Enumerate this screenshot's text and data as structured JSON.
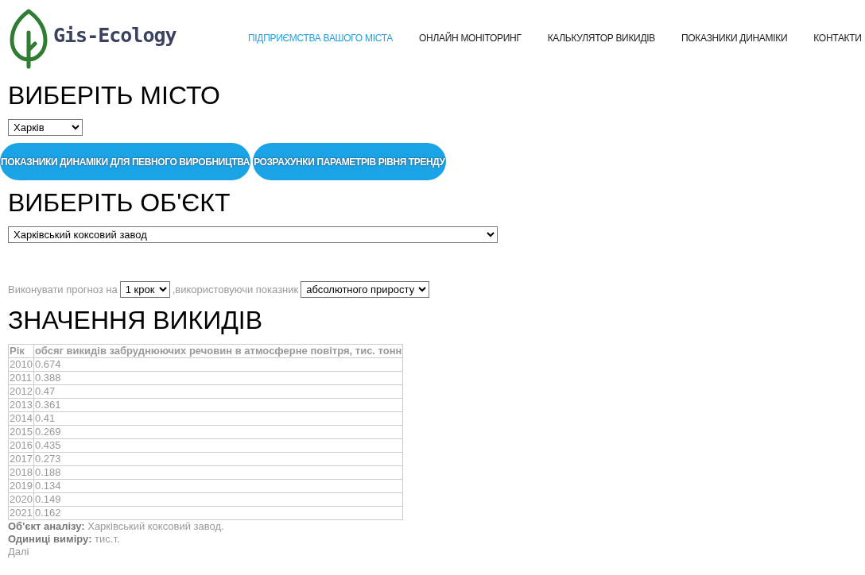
{
  "logo": {
    "text": "Gis-Ecology"
  },
  "nav": [
    {
      "label": "ПІДПРИЄМСТВА ВАШОГО МІСТА",
      "selected": true
    },
    {
      "label": "ОНЛАЙН МОНІТОРИНГ",
      "selected": false
    },
    {
      "label": "КАЛЬКУЛЯТОР ВИКИДІВ",
      "selected": false
    },
    {
      "label": "ПОКАЗНИКИ ДИНАМІКИ",
      "selected": false
    },
    {
      "label": "КОНТАКТИ",
      "selected": false
    }
  ],
  "city_heading": "ВИБЕРІТЬ МІСТО",
  "city_select": {
    "value": "Харків"
  },
  "buttons": [
    "ПОКАЗНИКИ ДИНАМІКИ ДЛЯ ПЕВНОГО ВИРОБНИЦТВА",
    "РОЗРАХУНКИ ПАРАМЕТРІВ РІВНЯ ТРЕНДУ"
  ],
  "object_heading": "ВИБЕРІТЬ ОБ'ЄКТ",
  "object_select": {
    "value": "Харківський коксовий завод"
  },
  "forecast": {
    "prefix": "Виконувати прогноз на",
    "steps": "1 крок",
    "middle": ",використовуючи показник",
    "indicator": "абсолютного приросту"
  },
  "values_heading": "ЗНАЧЕННЯ ВИКИДІВ",
  "table": {
    "columns": [
      "Рік",
      "обсяг викидів забруднюючих речовин в атмосферне повітря, тис. тонн"
    ],
    "rows": [
      [
        "2010",
        "0.674"
      ],
      [
        "2011",
        "0.388"
      ],
      [
        "2012",
        "0.47"
      ],
      [
        "2013",
        "0.361"
      ],
      [
        "2014",
        "0.41"
      ],
      [
        "2015",
        "0.269"
      ],
      [
        "2016",
        "0.435"
      ],
      [
        "2017",
        "0.273"
      ],
      [
        "2018",
        "0.188"
      ],
      [
        "2019",
        "0.134"
      ],
      [
        "2020",
        "0.149"
      ],
      [
        "2021",
        "0.162"
      ]
    ]
  },
  "info": [
    "**Об'єкт аналізу:** Харківський коксовий завод.",
    "**Одиниці виміру:** тис.т."
  ],
  "next_link": "Далі"
}
